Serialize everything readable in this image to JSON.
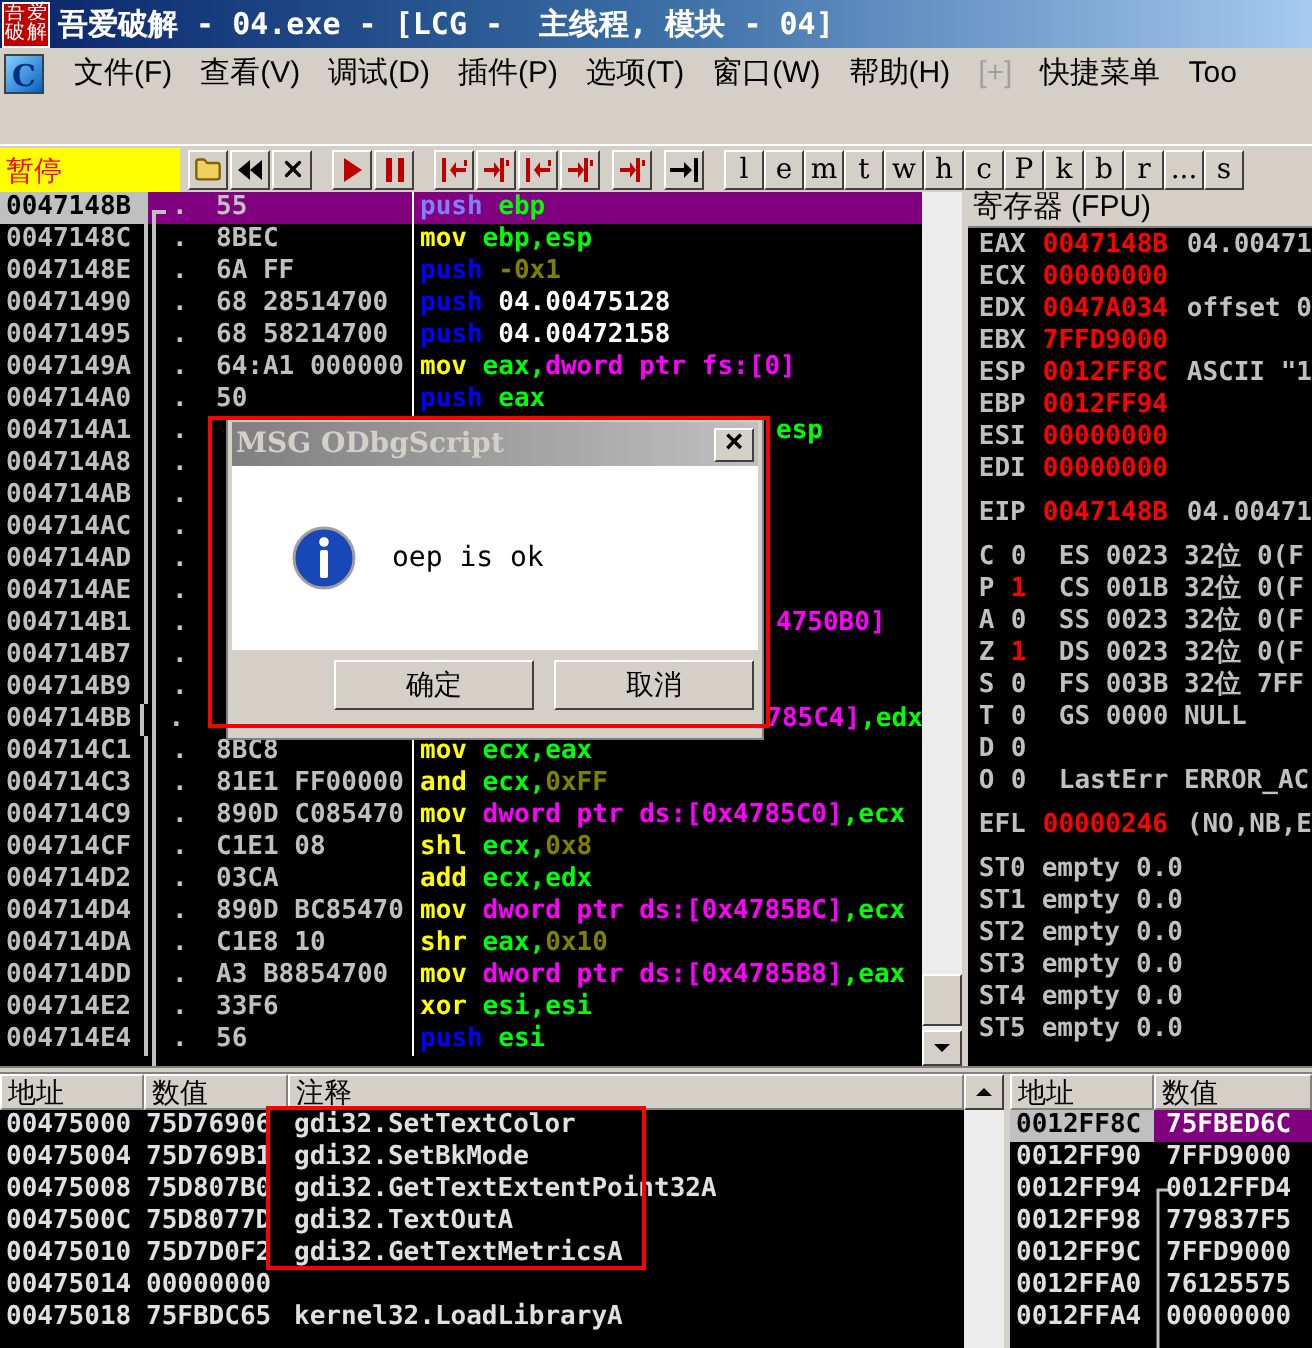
{
  "window": {
    "logo_text": "吾爱破解",
    "title": "吾爱破解 - 04.exe - [LCG -  主线程, 模块 - 04]"
  },
  "menu": {
    "app_letter": "C",
    "items": [
      {
        "label": "文件(F)",
        "disabled": false
      },
      {
        "label": "查看(V)",
        "disabled": false
      },
      {
        "label": "调试(D)",
        "disabled": false
      },
      {
        "label": "插件(P)",
        "disabled": false
      },
      {
        "label": "选项(T)",
        "disabled": false
      },
      {
        "label": "窗口(W)",
        "disabled": false
      },
      {
        "label": "帮助(H)",
        "disabled": false
      },
      {
        "label": "[+]",
        "disabled": true
      },
      {
        "label": "快捷菜单",
        "disabled": false
      },
      {
        "label": "Too",
        "disabled": false
      }
    ]
  },
  "toolbar": {
    "status": "暂停",
    "letters": [
      "l",
      "e",
      "m",
      "t",
      "w",
      "h",
      "c",
      "P",
      "k",
      "b",
      "r",
      "...",
      "s"
    ]
  },
  "disasm": {
    "rows": [
      {
        "addr": "0047148B",
        "mark": ".",
        "hex": "55",
        "selected": true,
        "asm": [
          {
            "text": "push",
            "kind": "kw"
          },
          {
            "text": " ebp",
            "kind": "reg"
          }
        ]
      },
      {
        "addr": "0047148C",
        "mark": ".",
        "hex": "8BEC",
        "selected": false,
        "asm": [
          {
            "text": "mov",
            "kind": "op"
          },
          {
            "text": " ebp,esp",
            "kind": "reg"
          }
        ]
      },
      {
        "addr": "0047148E",
        "mark": ".",
        "hex": "6A FF",
        "selected": false,
        "asm": [
          {
            "text": "push",
            "kind": "kw"
          },
          {
            "text": " -0x1",
            "kind": "imm"
          }
        ]
      },
      {
        "addr": "00471490",
        "mark": ".",
        "hex": "68 28514700",
        "selected": false,
        "asm": [
          {
            "text": "push",
            "kind": "kw"
          },
          {
            "text": " 04.00475128",
            "kind": "sym"
          }
        ]
      },
      {
        "addr": "00471495",
        "mark": ".",
        "hex": "68 58214700",
        "selected": false,
        "asm": [
          {
            "text": "push",
            "kind": "kw"
          },
          {
            "text": " 04.00472158",
            "kind": "sym"
          }
        ]
      },
      {
        "addr": "0047149A",
        "mark": ".",
        "hex": "64:A1 000000",
        "selected": false,
        "asm": [
          {
            "text": "mov",
            "kind": "op"
          },
          {
            "text": " eax,",
            "kind": "reg"
          },
          {
            "text": "dword ptr fs:[0]",
            "kind": "mem"
          }
        ]
      },
      {
        "addr": "004714A0",
        "mark": ".",
        "hex": "50",
        "selected": false,
        "asm": [
          {
            "text": "push",
            "kind": "kw"
          },
          {
            "text": " eax",
            "kind": "reg"
          }
        ]
      },
      {
        "addr": "004714A1",
        "mark": ".",
        "selected": false,
        "tail": [
          {
            "text": "esp",
            "kind": "reg"
          }
        ]
      },
      {
        "addr": "004714A8",
        "mark": ".",
        "selected": false
      },
      {
        "addr": "004714AB",
        "mark": ".",
        "selected": false
      },
      {
        "addr": "004714AC",
        "mark": ".",
        "selected": false
      },
      {
        "addr": "004714AD",
        "mark": ".",
        "selected": false
      },
      {
        "addr": "004714AE",
        "mark": ".",
        "selected": false
      },
      {
        "addr": "004714B1",
        "mark": ".",
        "selected": false,
        "tail": [
          {
            "text": "4750B0]",
            "kind": "mem"
          }
        ]
      },
      {
        "addr": "004714B7",
        "mark": ".",
        "selected": false
      },
      {
        "addr": "004714B9",
        "mark": ".",
        "selected": false
      },
      {
        "addr": "004714BB",
        "mark": ".",
        "selected": false,
        "tail": [
          {
            "text": "785C4]",
            "kind": "mem"
          },
          {
            "text": ",edx",
            "kind": "reg"
          }
        ]
      },
      {
        "addr": "004714C1",
        "mark": ".",
        "hex": "8BC8",
        "selected": false,
        "asm": [
          {
            "text": "mov",
            "kind": "op"
          },
          {
            "text": " ecx,eax",
            "kind": "reg"
          }
        ]
      },
      {
        "addr": "004714C3",
        "mark": ".",
        "hex": "81E1 FF00000",
        "selected": false,
        "asm": [
          {
            "text": "and",
            "kind": "op"
          },
          {
            "text": " ecx,",
            "kind": "reg"
          },
          {
            "text": "0xFF",
            "kind": "imm"
          }
        ]
      },
      {
        "addr": "004714C9",
        "mark": ".",
        "hex": "890D C085470",
        "selected": false,
        "asm": [
          {
            "text": "mov",
            "kind": "op"
          },
          {
            "text": " dword ptr ds:[0x4785C0]",
            "kind": "mem"
          },
          {
            "text": ",ecx",
            "kind": "reg"
          }
        ]
      },
      {
        "addr": "004714CF",
        "mark": ".",
        "hex": "C1E1 08",
        "selected": false,
        "asm": [
          {
            "text": "shl",
            "kind": "op"
          },
          {
            "text": " ecx,",
            "kind": "reg"
          },
          {
            "text": "0x8",
            "kind": "imm"
          }
        ]
      },
      {
        "addr": "004714D2",
        "mark": ".",
        "hex": "03CA",
        "selected": false,
        "asm": [
          {
            "text": "add",
            "kind": "op"
          },
          {
            "text": " ecx,edx",
            "kind": "reg"
          }
        ]
      },
      {
        "addr": "004714D4",
        "mark": ".",
        "hex": "890D BC85470",
        "selected": false,
        "asm": [
          {
            "text": "mov",
            "kind": "op"
          },
          {
            "text": " dword ptr ds:[0x4785BC]",
            "kind": "mem"
          },
          {
            "text": ",ecx",
            "kind": "reg"
          }
        ]
      },
      {
        "addr": "004714DA",
        "mark": ".",
        "hex": "C1E8 10",
        "selected": false,
        "asm": [
          {
            "text": "shr",
            "kind": "op"
          },
          {
            "text": " eax,",
            "kind": "reg"
          },
          {
            "text": "0x10",
            "kind": "imm"
          }
        ]
      },
      {
        "addr": "004714DD",
        "mark": ".",
        "hex": "A3 B8854700",
        "selected": false,
        "asm": [
          {
            "text": "mov",
            "kind": "op"
          },
          {
            "text": " dword ptr ds:[0x4785B8]",
            "kind": "mem"
          },
          {
            "text": ",eax",
            "kind": "reg"
          }
        ]
      },
      {
        "addr": "004714E2",
        "mark": ".",
        "hex": "33F6",
        "selected": false,
        "asm": [
          {
            "text": "xor",
            "kind": "op"
          },
          {
            "text": " esi,esi",
            "kind": "reg"
          }
        ]
      },
      {
        "addr": "004714E4",
        "mark": ".",
        "hex": "56",
        "selected": false,
        "asm": [
          {
            "text": "push",
            "kind": "kw"
          },
          {
            "text": " esi",
            "kind": "reg"
          }
        ]
      }
    ]
  },
  "dialog": {
    "title": "MSG ODbgScript",
    "close": "×",
    "message": "oep is ok",
    "buttons": [
      "确定",
      "取消"
    ]
  },
  "registers": {
    "title": "寄存器 (FPU)",
    "general": [
      {
        "name": "EAX",
        "value": "0047148B",
        "changed": true,
        "comment": "04.00471"
      },
      {
        "name": "ECX",
        "value": "00000000",
        "changed": true
      },
      {
        "name": "EDX",
        "value": "0047A034",
        "changed": true,
        "comment": "offset 0"
      },
      {
        "name": "EBX",
        "value": "7FFD9000",
        "changed": true
      },
      {
        "name": "ESP",
        "value": "0012FF8C",
        "changed": true,
        "comment": "ASCII \"1"
      },
      {
        "name": "EBP",
        "value": "0012FF94",
        "changed": true
      },
      {
        "name": "ESI",
        "value": "00000000",
        "changed": true
      },
      {
        "name": "EDI",
        "value": "00000000",
        "changed": true
      }
    ],
    "eip": {
      "name": "EIP",
      "value": "0047148B",
      "changed": true,
      "comment": "04.00471"
    },
    "flags": [
      {
        "flag": "C",
        "value": "0",
        "changed": false,
        "info": "ES 0023 32位 0(F"
      },
      {
        "flag": "P",
        "value": "1",
        "changed": true,
        "info": "CS 001B 32位 0(F"
      },
      {
        "flag": "A",
        "value": "0",
        "changed": false,
        "info": "SS 0023 32位 0(F"
      },
      {
        "flag": "Z",
        "value": "1",
        "changed": true,
        "info": "DS 0023 32位 0(F"
      },
      {
        "flag": "S",
        "value": "0",
        "changed": false,
        "info": "FS 003B 32位 7FF"
      },
      {
        "flag": "T",
        "value": "0",
        "changed": false,
        "info": "GS 0000 NULL"
      },
      {
        "flag": "D",
        "value": "0",
        "changed": false
      },
      {
        "flag": "O",
        "value": "0",
        "changed": false,
        "info": "LastErr ERROR_AC"
      }
    ],
    "efl": {
      "name": "EFL",
      "value": "00000246",
      "changed": true,
      "comment": "(NO,NB,E"
    },
    "fpu": [
      {
        "name": "ST0",
        "tag": "empty",
        "value": "0.0"
      },
      {
        "name": "ST1",
        "tag": "empty",
        "value": "0.0"
      },
      {
        "name": "ST2",
        "tag": "empty",
        "value": "0.0"
      },
      {
        "name": "ST3",
        "tag": "empty",
        "value": "0.0"
      },
      {
        "name": "ST4",
        "tag": "empty",
        "value": "0.0"
      },
      {
        "name": "ST5",
        "tag": "empty",
        "value": "0.0"
      }
    ]
  },
  "dump": {
    "columns": [
      "地址",
      "数值",
      "注释"
    ],
    "rows": [
      {
        "addr": "00475000",
        "value": "75D76906",
        "comment": "gdi32.SetTextColor"
      },
      {
        "addr": "00475004",
        "value": "75D769B1",
        "comment": "gdi32.SetBkMode"
      },
      {
        "addr": "00475008",
        "value": "75D807B0",
        "comment": "gdi32.GetTextExtentPoint32A"
      },
      {
        "addr": "0047500C",
        "value": "75D8077D",
        "comment": "gdi32.TextOutA"
      },
      {
        "addr": "00475010",
        "value": "75D7D0F2",
        "comment": "gdi32.GetTextMetricsA"
      },
      {
        "addr": "00475014",
        "value": "00000000"
      },
      {
        "addr": "00475018",
        "value": "75FBDC65",
        "comment": "kernel32.LoadLibraryA"
      }
    ]
  },
  "stack": {
    "columns": [
      "地址",
      "数值"
    ],
    "rows": [
      {
        "addr": "0012FF8C",
        "value": "75FBED6C",
        "selected": true
      },
      {
        "addr": "0012FF90",
        "value": "7FFD9000",
        "selected": false
      },
      {
        "addr": "0012FF94",
        "value": "0012FFD4",
        "selected": false
      },
      {
        "addr": "0012FF98",
        "value": "779837F5",
        "selected": false
      },
      {
        "addr": "0012FF9C",
        "value": "7FFD9000",
        "selected": false
      },
      {
        "addr": "0012FFA0",
        "value": "76125575",
        "selected": false
      },
      {
        "addr": "0012FFA4",
        "value": "00000000",
        "selected": false
      }
    ]
  }
}
